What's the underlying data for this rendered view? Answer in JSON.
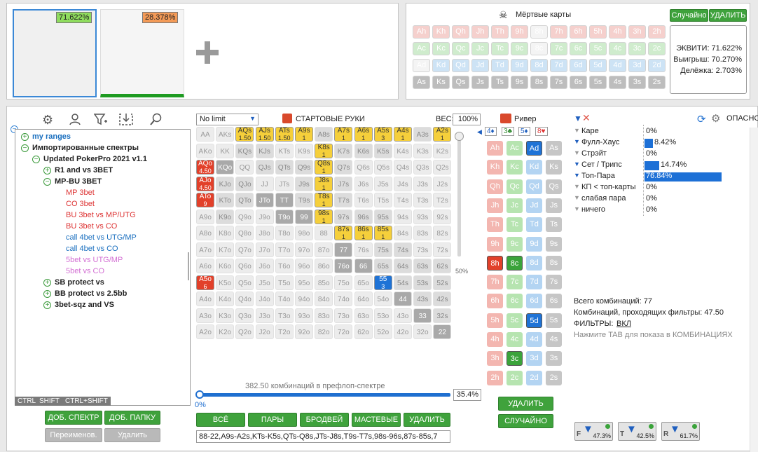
{
  "top": {
    "equity_a": "71.622%",
    "equity_b": "28.378%",
    "dead_cards_title": "Мёртвые карты",
    "random_btn": "Случайно",
    "delete_btn": "УДАЛИТЬ",
    "equity_label": "ЭКВИТИ: 71.622%",
    "win_label": "Выигрыш: 70.270%",
    "tie_label": "Делёжка: 2.703%",
    "dead_rows": [
      [
        "Ah",
        "Kh",
        "Qh",
        "Jh",
        "Th",
        "9h",
        "8h",
        "7h",
        "6h",
        "5h",
        "4h",
        "3h",
        "2h"
      ],
      [
        "Ac",
        "Kc",
        "Qc",
        "Jc",
        "Tc",
        "9c",
        "8c",
        "7c",
        "6c",
        "5c",
        "4c",
        "3c",
        "2c"
      ],
      [
        "Ad",
        "Kd",
        "Qd",
        "Jd",
        "Td",
        "9d",
        "8d",
        "7d",
        "6d",
        "5d",
        "4d",
        "3d",
        "2d"
      ],
      [
        "As",
        "Ks",
        "Qs",
        "Js",
        "Ts",
        "9s",
        "8s",
        "7s",
        "6s",
        "5s",
        "4s",
        "3s",
        "2s"
      ]
    ]
  },
  "tree": {
    "tabs": [
      "CTRL",
      "SHIFT",
      "CTRL+SHIFT"
    ],
    "items": [
      {
        "label": "my ranges",
        "color": "#1a6fbf",
        "bold": true
      },
      {
        "label": "Импортированные спектры",
        "color": "#222",
        "bold": true
      },
      {
        "label": "Updated PokerPro 2021 v1.1",
        "color": "#222",
        "bold": true
      },
      {
        "label": "R1 and vs 3BET",
        "color": "#222",
        "bold": true
      },
      {
        "label": "MP-BU 3BET",
        "color": "#222",
        "bold": true
      },
      {
        "label": "MP 3bet",
        "color": "#d33",
        "bold": false
      },
      {
        "label": "CO 3bet",
        "color": "#d33",
        "bold": false
      },
      {
        "label": "BU 3bet vs MP/UTG",
        "color": "#d33",
        "bold": false
      },
      {
        "label": "BU 3bet vs CO",
        "color": "#d33",
        "bold": false
      },
      {
        "label": "call 4bet vs UTG/MP",
        "color": "#1a6fbf",
        "bold": false
      },
      {
        "label": "call 4bet vs CO",
        "color": "#1a6fbf",
        "bold": false
      },
      {
        "label": "5bet vs UTG/MP",
        "color": "#d36fd3",
        "bold": false
      },
      {
        "label": "5bet vs CO",
        "color": "#d36fd3",
        "bold": false
      },
      {
        "label": "SB protect vs",
        "color": "#222",
        "bold": true
      },
      {
        "label": "BB protect vs 2.5bb",
        "color": "#222",
        "bold": true
      },
      {
        "label": "3bet-sqz and VS",
        "color": "#222",
        "bold": true
      }
    ],
    "add_range_btn": "ДОБ. СПЕКТР",
    "add_folder_btn": "ДОБ. ПАПКУ",
    "rename_btn": "Переименов.",
    "delete_btn": "Удалить"
  },
  "range": {
    "limit": "No limit",
    "title": "СТАРТОВЫЕ РУКИ",
    "weight_label": "ВЕС:",
    "weight_value": "100%",
    "slider_pct": "50%",
    "combos_text": "382.50 комбинаций в префлоп-спектре",
    "slider_left": "0%",
    "slider_right": "35.4%",
    "btn_all": "ВСЁ",
    "btn_pairs": "ПАРЫ",
    "btn_broadway": "БРОДВЕЙ",
    "btn_suited": "МАСТЕВЫЕ",
    "btn_delete": "УДАЛИТЬ",
    "range_string": "88-22,A9s-A2s,KTs-K5s,QTs-Q8s,JTs-J8s,T9s-T7s,98s-96s,87s-85s,7",
    "ranks": [
      "A",
      "K",
      "Q",
      "J",
      "T",
      "9",
      "8",
      "7",
      "6",
      "5",
      "4",
      "3",
      "2"
    ]
  },
  "river": {
    "title": "Ривер",
    "suit_counts": [
      "4♦",
      "3♣",
      "5♦",
      "8♥"
    ],
    "delete_btn": "УДАЛИТЬ",
    "random_btn": "СЛУЧАЙНО"
  },
  "stats": {
    "hint_right": "ОПАСНО",
    "rows": [
      {
        "label": "Каре",
        "pct": "0%",
        "val": 0
      },
      {
        "label": "Фулл-Хаус",
        "pct": "8.42%",
        "val": 8.42
      },
      {
        "label": "Стрэйт",
        "pct": "0%",
        "val": 0
      },
      {
        "label": "Сет / Трипс",
        "pct": "14.74%",
        "val": 14.74
      },
      {
        "label": "Топ-Пара",
        "pct": "76.84%",
        "val": 76.84
      },
      {
        "label": "КП < топ-карты",
        "pct": "0%",
        "val": 0
      },
      {
        "label": "слабая пара",
        "pct": "0%",
        "val": 0
      },
      {
        "label": "ничего",
        "pct": "0%",
        "val": 0
      }
    ],
    "total_combos": "Всего комбинаций: 77",
    "filtered_combos": "Комбинаций, проходящих фильтры: 47.50",
    "filters_label": "ФИЛЬТРЫ:",
    "filters_value": "ВКЛ",
    "tab_hint": "Нажмите TAB для показа в КОМБИНАЦИЯХ",
    "f_pct": "47.3%",
    "t_pct": "42.5%",
    "r_pct": "61.7%"
  }
}
